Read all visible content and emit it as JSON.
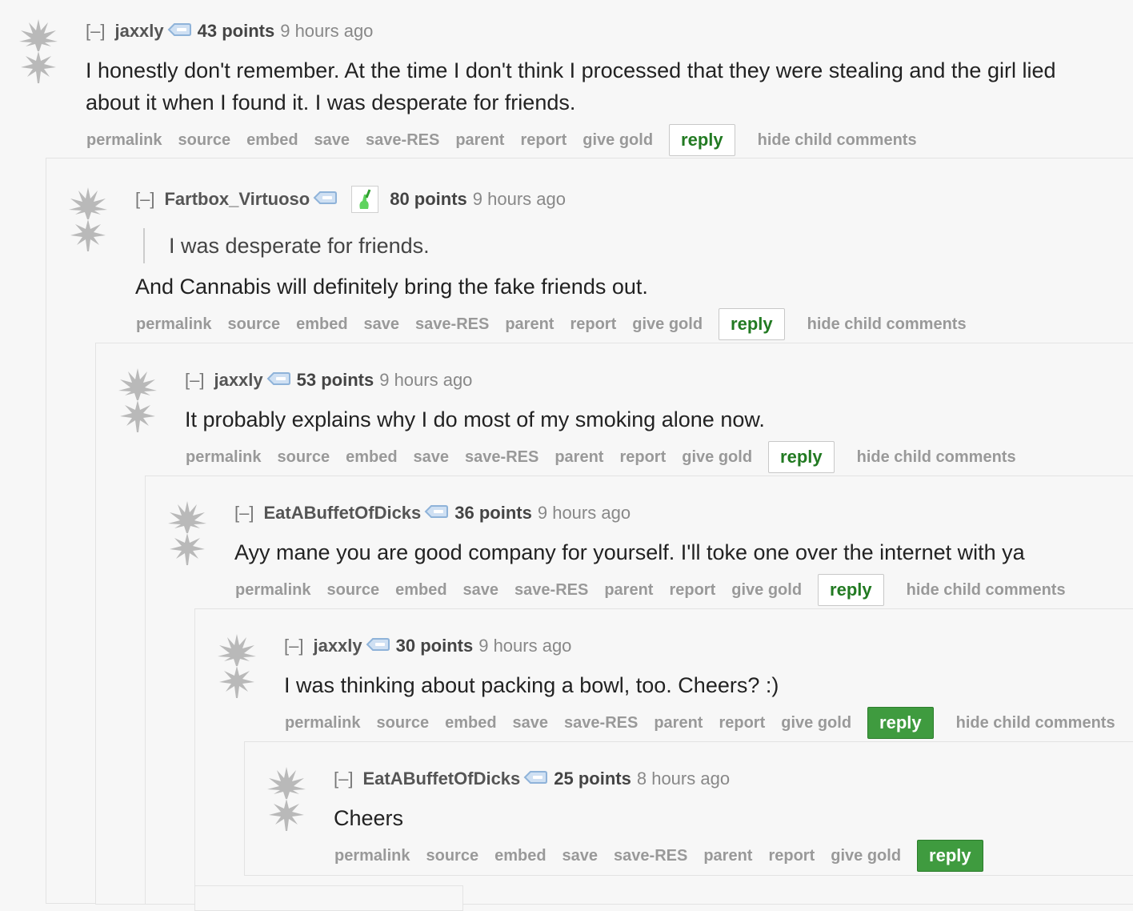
{
  "colors": {
    "background": "#f7f7f7",
    "reply_text": "#227a22",
    "reply_active_bg": "#3f9b3f",
    "action_text": "#999999"
  },
  "actions": [
    "permalink",
    "source",
    "embed",
    "save",
    "save-RES",
    "parent",
    "report",
    "give gold"
  ],
  "reply_label": "reply",
  "hide_child_label": "hide child comments",
  "collapse_label": "[–]",
  "comments": [
    {
      "author": "jaxxly",
      "points": "43 points",
      "time": "9 hours ago",
      "body": "I honestly don't remember. At the time I don't think I processed that they were stealing and the girl lied about it when I found it. I was desperate for friends.",
      "quote": "",
      "has_flair": false,
      "reply_active": false,
      "show_hide_child": true
    },
    {
      "author": "Fartbox_Virtuoso",
      "points": "80 points",
      "time": "9 hours ago",
      "quote": "I was desperate for friends.",
      "body": "And Cannabis will definitely bring the fake friends out.",
      "has_flair": true,
      "reply_active": false,
      "show_hide_child": true
    },
    {
      "author": "jaxxly",
      "points": "53 points",
      "time": "9 hours ago",
      "body": "It probably explains why I do most of my smoking alone now.",
      "quote": "",
      "has_flair": false,
      "reply_active": false,
      "show_hide_child": true
    },
    {
      "author": "EatABuffetOfDicks",
      "points": "36 points",
      "time": "9 hours ago",
      "body": "Ayy mane you are good company for yourself. I'll toke one over the internet with ya",
      "quote": "",
      "has_flair": false,
      "reply_active": false,
      "show_hide_child": true
    },
    {
      "author": "jaxxly",
      "points": "30 points",
      "time": "9 hours ago",
      "body": "I was thinking about packing a bowl, too. Cheers? :)",
      "quote": "",
      "has_flair": false,
      "reply_active": true,
      "show_hide_child": true
    },
    {
      "author": "EatABuffetOfDicks",
      "points": "25 points",
      "time": "8 hours ago",
      "body": "Cheers",
      "quote": "",
      "has_flair": false,
      "reply_active": true,
      "show_hide_child": false
    }
  ]
}
